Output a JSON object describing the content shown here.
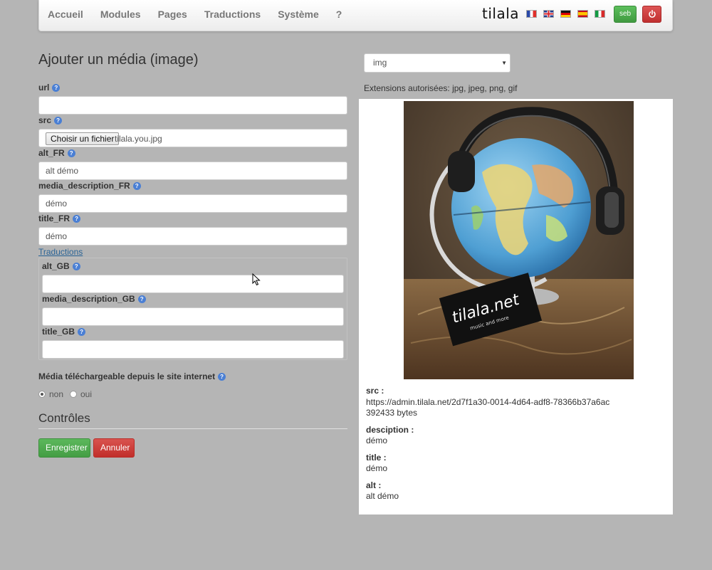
{
  "nav": {
    "links": [
      "Accueil",
      "Modules",
      "Pages",
      "Traductions",
      "Système",
      "?"
    ],
    "brand": "tilala",
    "flags": [
      "flag-fr",
      "flag-gb",
      "flag-de",
      "flag-es",
      "flag-it"
    ],
    "user_label": "seb",
    "power_icon": "power-icon"
  },
  "form": {
    "title": "Ajouter un média (image)",
    "url_label": "url",
    "url_value": "",
    "src_label": "src",
    "file_button": "Choisir un fichier",
    "file_name": "tilala.you.jpg",
    "alt_fr_label": "alt_FR",
    "alt_fr_value": "alt démo",
    "desc_fr_label": "media_description_FR",
    "desc_fr_value": "démo",
    "title_fr_label": "title_FR",
    "title_fr_value": "démo",
    "translations_link": "Traductions",
    "alt_gb_label": "alt_GB",
    "alt_gb_value": "",
    "desc_gb_label": "media_description_GB",
    "desc_gb_value": "",
    "title_gb_label": "title_GB",
    "title_gb_value": "",
    "downloadable_label": "Média téléchargeable depuis le site internet",
    "radio_no": "non",
    "radio_yes": "oui",
    "radio_selected": "non",
    "controls_title": "Contrôles",
    "save_button": "Enregistrer",
    "cancel_button": "Annuler"
  },
  "preview": {
    "type_select": "img",
    "extensions": "Extensions autorisées: jpg, jpeg, png, gif",
    "image_logo_text": "tilala.net",
    "image_logo_sub": "music and more",
    "src_label": "src :",
    "src_value": "https://admin.tilala.net/2d7f1a30-0014-4d64-adf8-78366b37a6ac",
    "size_value": "392433 bytes",
    "description_label": "desciption :",
    "description_value": "démo",
    "title_label": "title :",
    "title_value": "démo",
    "alt_label": "alt :",
    "alt_value": "alt démo"
  },
  "colors": {
    "background": "#b5b5b5",
    "success": "#5cb85c",
    "danger": "#d9534f",
    "help": "#4a7fd4",
    "link": "#2a6496"
  }
}
